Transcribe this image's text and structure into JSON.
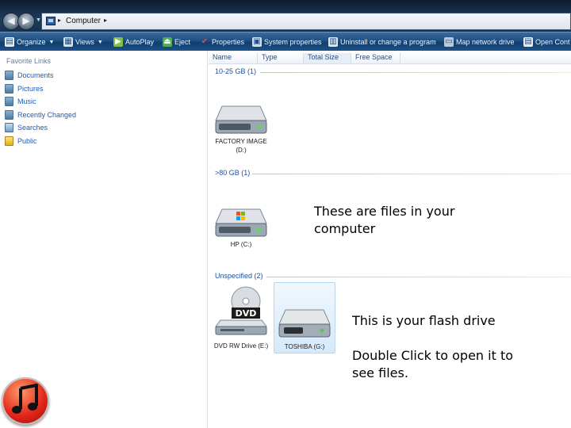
{
  "address_bar": {
    "location": "Computer",
    "separator_glyph": "▸"
  },
  "toolbar": {
    "items": [
      {
        "label": "Organize",
        "icon": "organize-icon",
        "has_dropdown": true
      },
      {
        "label": "Views",
        "icon": "views-icon",
        "has_dropdown": true
      },
      {
        "label": "AutoPlay",
        "icon": "autoplay-icon",
        "has_dropdown": false
      },
      {
        "label": "Eject",
        "icon": "eject-icon",
        "has_dropdown": false
      },
      {
        "label": "Properties",
        "icon": "properties-icon",
        "has_dropdown": false
      },
      {
        "label": "System properties",
        "icon": "system-properties-icon",
        "has_dropdown": false
      },
      {
        "label": "Uninstall or change a program",
        "icon": "uninstall-icon",
        "has_dropdown": false
      },
      {
        "label": "Map network drive",
        "icon": "map-network-drive-icon",
        "has_dropdown": false
      },
      {
        "label": "Open Cont",
        "icon": "control-panel-icon",
        "has_dropdown": false
      }
    ]
  },
  "nav_pane": {
    "title": "Favorite Links",
    "items": [
      {
        "label": "Documents",
        "icon": "documents-icon"
      },
      {
        "label": "Pictures",
        "icon": "pictures-icon"
      },
      {
        "label": "Music",
        "icon": "music-icon"
      },
      {
        "label": "Recently Changed",
        "icon": "recently-changed-icon"
      },
      {
        "label": "Searches",
        "icon": "searches-icon"
      },
      {
        "label": "Public",
        "icon": "public-folder-icon"
      }
    ]
  },
  "columns": [
    "Name",
    "Type",
    "Total Size",
    "Free Space"
  ],
  "groups": [
    {
      "label": "10-25 GB (1)",
      "drives": [
        {
          "label_line1": "FACTORY IMAGE",
          "label_line2": "(D:)"
        }
      ]
    },
    {
      "label": ">80 GB (1)",
      "drives": [
        {
          "label_line1": "HP (C:)",
          "label_line2": ""
        }
      ]
    },
    {
      "label": "Unspecified (2)",
      "drives": [
        {
          "label_line1": "DVD RW Drive (E:)",
          "label_line2": "",
          "badge": "DVD"
        },
        {
          "label_line1": "TOSHIBA (G:)",
          "label_line2": "",
          "selected": true
        }
      ]
    }
  ],
  "annotations": {
    "files_note": "These are files in your computer",
    "flash_note_1": "This is your flash drive",
    "flash_note_2": "Double Click to open it to see files."
  },
  "taskbar": {
    "media_icon": "media-player-icon"
  }
}
